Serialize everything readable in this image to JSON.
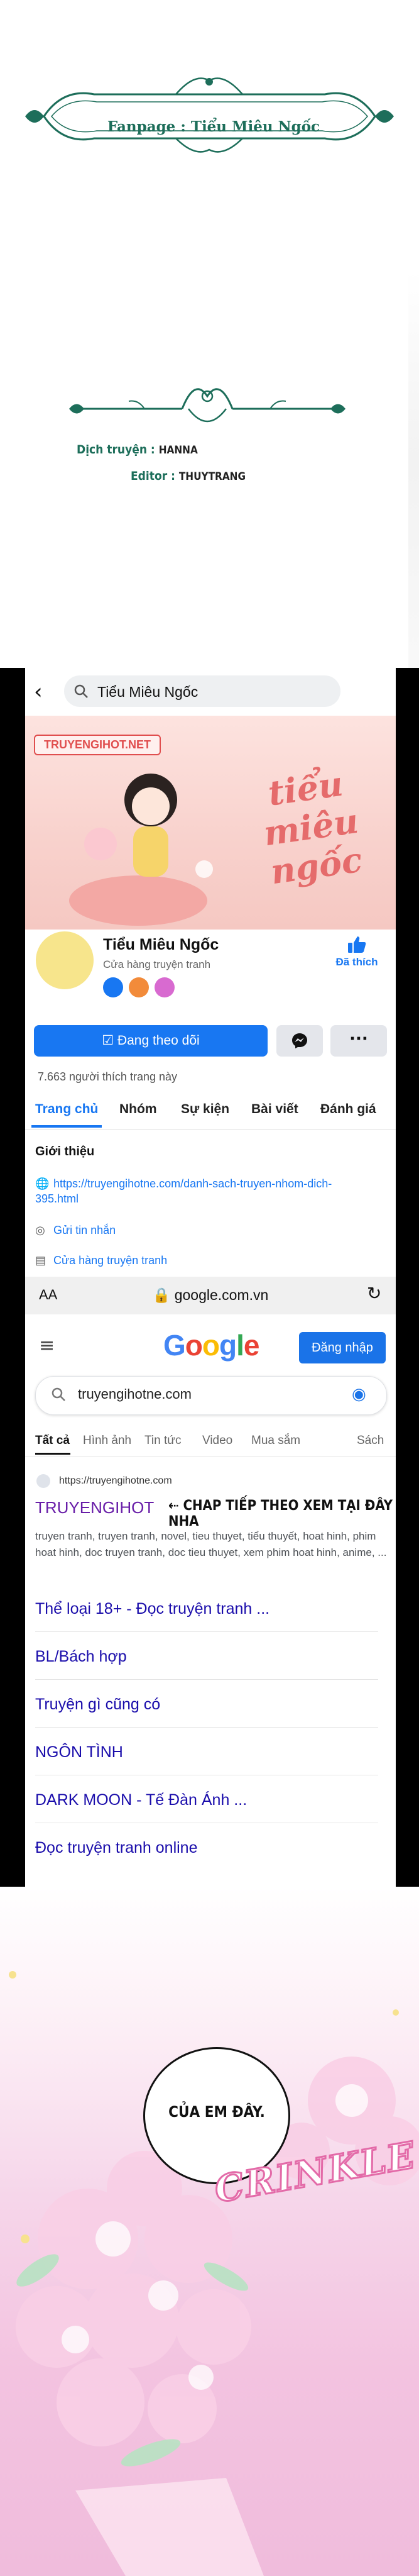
{
  "header": {
    "fanpage": "Fanpage : Tiểu Miêu Ngốc",
    "credits": [
      {
        "label": "Dịch truyện :",
        "value": "HANNA"
      },
      {
        "label": "Editor :",
        "value": "THUYTRANG"
      }
    ]
  },
  "facebook": {
    "search_text": "Tiểu Miêu Ngốc",
    "cover_badge": "TRUYENGIHOT.NET",
    "cover_title": "tiểu miêu ngốc",
    "page_name": "Tiểu Miêu Ngốc",
    "page_category": "Cửa hàng truyện tranh",
    "liked_label": "Đã thích",
    "follow_button": "Đang theo dõi",
    "more_label": "···",
    "likes_count": "7.663 người thích trang này",
    "tabs": [
      "Trang chủ",
      "Nhóm",
      "Sự kiện",
      "Bài viết",
      "Đánh giá"
    ],
    "intro_title": "Giới thiệu",
    "intro_items": [
      {
        "icon": "globe-icon",
        "text": "https://truyengihotne.com/danh-sach-truyen-nhom-dich-395.html"
      },
      {
        "icon": "messenger-icon",
        "text": "Gửi tin nhắn"
      },
      {
        "icon": "shop-icon",
        "text": "Cửa hàng truyện tranh"
      }
    ]
  },
  "browser": {
    "aa": "AA",
    "url": "google.com.vn"
  },
  "google": {
    "logo": "Google",
    "login_button": "Đăng nhập",
    "query": "truyengihotne.com",
    "tabs": [
      "Tất cả",
      "Hình ảnh",
      "Tin tức",
      "Video",
      "Mua sắm",
      "Sách"
    ],
    "result_source": "https://truyengihotne.com",
    "result_title": "TRUYENGIHOT",
    "result_cta": "⇠ CHAP TIẾP THEO XEM TẠI ĐÂY NHA",
    "result_snippet": "truyen tranh, truyen tranh, novel, tieu thuyet, tiểu thuyết, hoat hinh, phim hoat hinh, doc truyen tranh, doc tieu thuyet, xem phim hoat hinh, anime, ...",
    "sitelinks": [
      "Thể loại 18+ - Đọc truyện tranh ...",
      "BL/Bách hợp",
      "Truyện gì cũng có",
      "NGÔN TÌNH",
      "DARK MOON - Tế Đàn Ánh ...",
      "Đọc truyện tranh online"
    ]
  },
  "comic": {
    "speech": "CỦA EM ĐÂY.",
    "sfx": "CRINKLE"
  },
  "colors": {
    "brand_green": "#1d6e5a",
    "facebook_blue": "#1877f2",
    "google_blue": "#1a73e8",
    "link_blue": "#1a0dab",
    "visited_purple": "#681da8"
  }
}
